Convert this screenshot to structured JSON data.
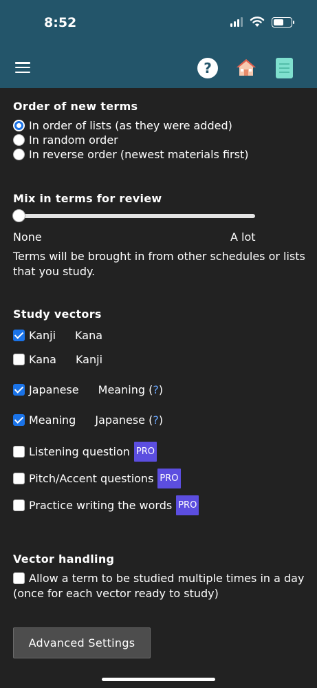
{
  "status_bar": {
    "time": "8:52"
  },
  "colors": {
    "header": "#23556a",
    "background": "#222222",
    "accent": "#1a73e8",
    "pro_badge": "#5c4ee0"
  },
  "nav": {
    "icons": [
      "menu-icon",
      "help-icon",
      "home-icon",
      "book-icon"
    ],
    "help_glyph": "?"
  },
  "order_section": {
    "title": "Order of new terms",
    "options": [
      {
        "label": "In order of lists (as they were added)",
        "selected": true
      },
      {
        "label": "In random order",
        "selected": false
      },
      {
        "label": "In reverse order (newest materials first)",
        "selected": false
      }
    ]
  },
  "mix_section": {
    "title": "Mix in terms for review",
    "slider_value": 0,
    "min_label": "None",
    "max_label": "A lot",
    "description": "Terms will be brought in from other schedules or lists that you study."
  },
  "vectors_section": {
    "title": "Study vectors",
    "items": [
      {
        "from": "Kanji",
        "to": "Kana",
        "checked": true
      },
      {
        "from": "Kana",
        "to": "Kanji",
        "checked": false
      },
      {
        "from": "Japanese",
        "to": "Meaning (",
        "help": "?",
        "close": ")",
        "checked": true
      },
      {
        "from": "Meaning",
        "to": "Japanese (",
        "help": "?",
        "close": ")",
        "checked": true
      },
      {
        "label": "Listening question",
        "badge": "PRO",
        "checked": false
      },
      {
        "label": "Pitch/Accent questions",
        "badge": "PRO",
        "checked": false
      },
      {
        "label": "Practice writing the words",
        "badge": "PRO",
        "checked": false
      }
    ]
  },
  "handling_section": {
    "title": "Vector handling",
    "line1": "Allow a term to be studied multiple times in a day",
    "line2": "(once for each vector ready to study)",
    "checked": false
  },
  "advanced_button": "Advanced Settings"
}
